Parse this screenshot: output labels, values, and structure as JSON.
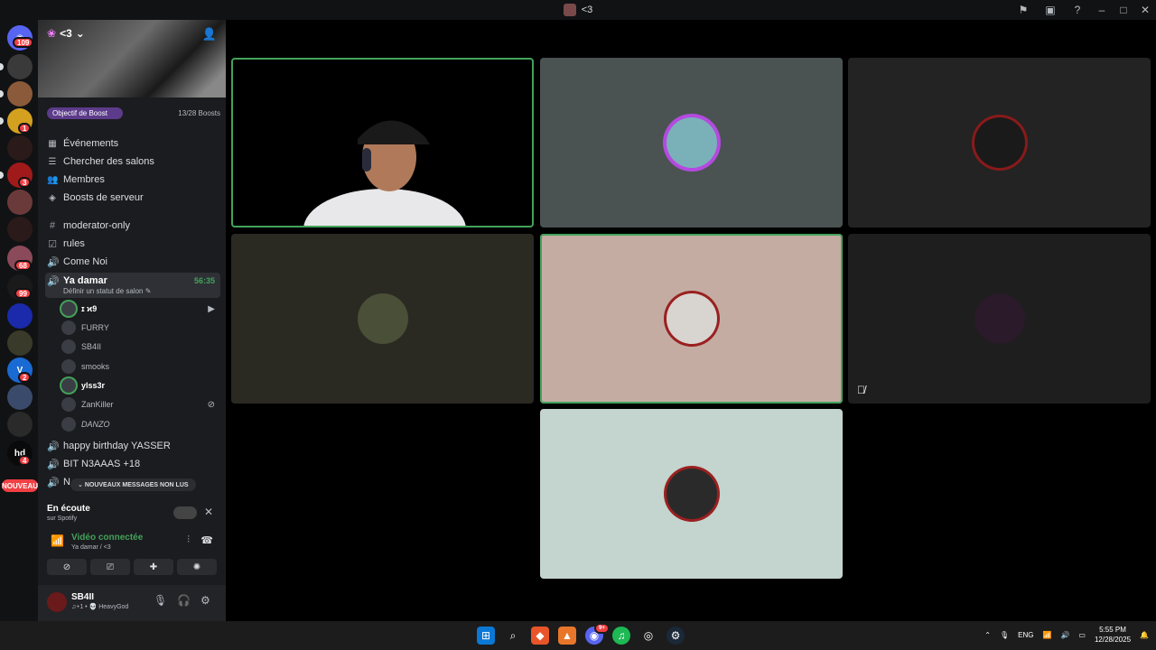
{
  "titlebar": {
    "title": "<3",
    "icons": [
      "inbox-icon",
      "stream-icon",
      "help-icon",
      "minimize-icon",
      "maximize-icon",
      "close-icon"
    ]
  },
  "servers": {
    "home_badge": "109",
    "badges": {
      "s3": "1",
      "s6": "3",
      "s9": "68",
      "s10": "99",
      "s12": "2",
      "s15": "4"
    },
    "nouveau_label": "NOUVEAU"
  },
  "guild": {
    "name": "<3",
    "boost_goal": "Objectif de Boost",
    "boost_count": "13/28 Boosts",
    "menu": [
      {
        "label": "Événements",
        "icon": "calendar-icon"
      },
      {
        "label": "Chercher des salons",
        "icon": "channel-browse-icon"
      },
      {
        "label": "Membres",
        "icon": "members-icon"
      },
      {
        "label": "Boosts de serveur",
        "icon": "boost-icon"
      }
    ]
  },
  "channels": [
    {
      "label": "moderator-only",
      "icon": "text-channel-icon"
    },
    {
      "label": "rules",
      "icon": "rules-icon"
    },
    {
      "label": "Come Noi",
      "icon": "voice-icon"
    }
  ],
  "active_channel": {
    "label": "Ya damar",
    "timer": "56:35",
    "status_hint": "Définir un statut de salon"
  },
  "voice_users": [
    {
      "name": "ɪ ϰ9",
      "speaking": true,
      "right": "camera-icon"
    },
    {
      "name": "FURRY",
      "speaking": false
    },
    {
      "name": "SB4II",
      "speaking": false
    },
    {
      "name": "smooks",
      "speaking": false
    },
    {
      "name": "ylss3r",
      "speaking": true
    },
    {
      "name": "ZanKiller",
      "speaking": false,
      "right": "deafened-icon"
    },
    {
      "name": "DANZO",
      "speaking": false
    }
  ],
  "more_channels": [
    {
      "label": "happy birthday YASSER",
      "icon": "voice-icon"
    },
    {
      "label": "BIT N3AAAS +18",
      "icon": "voice-icon"
    },
    {
      "label": "N",
      "icon": "voice-icon"
    }
  ],
  "new_messages": "NOUVEAUX MESSAGES NON LUS",
  "listening": {
    "title": "En écoute",
    "subtitle": "sur Spotify"
  },
  "voice_connection": {
    "status": "Vidéo connectée",
    "location": "Ya damar / <3"
  },
  "user_panel": {
    "name": "SB4II",
    "status": "♫+1 • 💀 HeavyGod"
  },
  "tiles": [
    {
      "id": "camera",
      "bg": "#000000",
      "speaking": true
    },
    {
      "id": "t2",
      "bg": "#4a5352",
      "ring": "#b44ae0",
      "speaking": false
    },
    {
      "id": "t3",
      "bg": "#232323",
      "ring": "#8a1a1a",
      "speaking": false
    },
    {
      "id": "t4",
      "bg": "#2a2a22",
      "ring": "#3a3d30",
      "speaking": false
    },
    {
      "id": "t5",
      "bg": "#c4aca3",
      "ring": "#9a2020",
      "speaking": true
    },
    {
      "id": "t6",
      "bg": "#1e1e1e",
      "ring": "#4a2a3a",
      "speaking": false,
      "muted": true
    },
    {
      "id": "t7",
      "bg": "#c4d4cf",
      "ring": "#9a2020",
      "speaking": false
    }
  ],
  "taskbar": {
    "lang": "ENG",
    "time": "5:55 PM",
    "date": "12/28/2025",
    "discord_badge": "9+"
  }
}
